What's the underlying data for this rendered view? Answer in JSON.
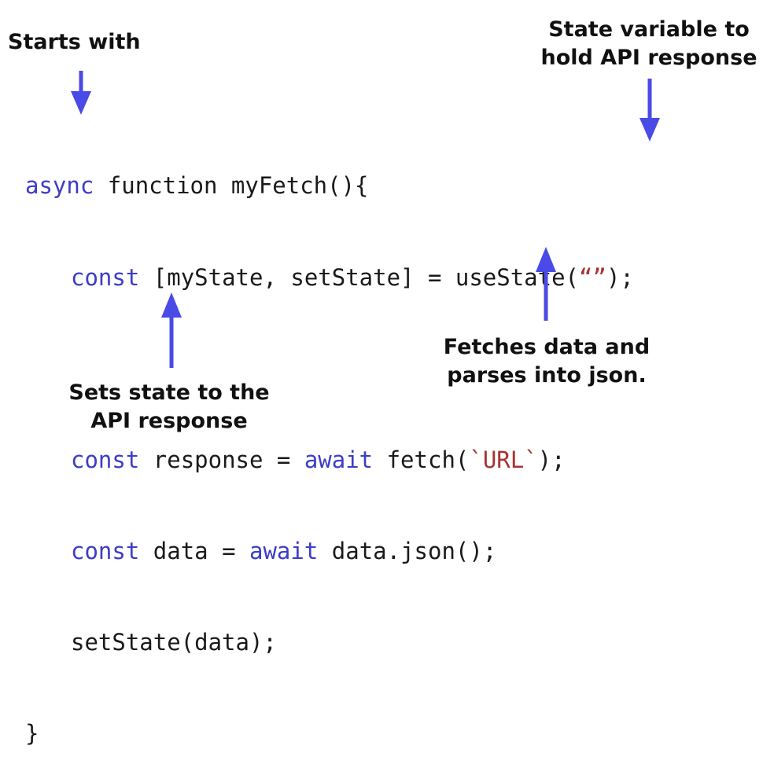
{
  "labels": {
    "starts_with": "Starts with",
    "state_variable": [
      "State variable to",
      "hold API response"
    ],
    "fetches": [
      "Fetches data and",
      "parses into json."
    ],
    "sets_state": [
      "Sets state to the",
      "API response"
    ]
  },
  "code": {
    "line1": {
      "kw": "async",
      "rest": " function myFetch(){"
    },
    "line2": {
      "kw": "const",
      "rest": " [myState, setState] = useState(",
      "str": "“”",
      "end": ");"
    },
    "line4": {
      "kw": "const",
      "mid": " response = ",
      "kw2": "await",
      "rest": " fetch(",
      "str": "`URL`",
      "end": ");"
    },
    "line5": {
      "kw": "const",
      "mid": " data = ",
      "kw2": "await",
      "rest": " data.json();"
    },
    "line6": {
      "text": "setState(data);"
    },
    "line7": {
      "text": "}"
    }
  },
  "colors": {
    "arrow": "#4a4ae6",
    "keyword": "#3c3cc8",
    "string": "#a83232",
    "text": "#111111"
  }
}
